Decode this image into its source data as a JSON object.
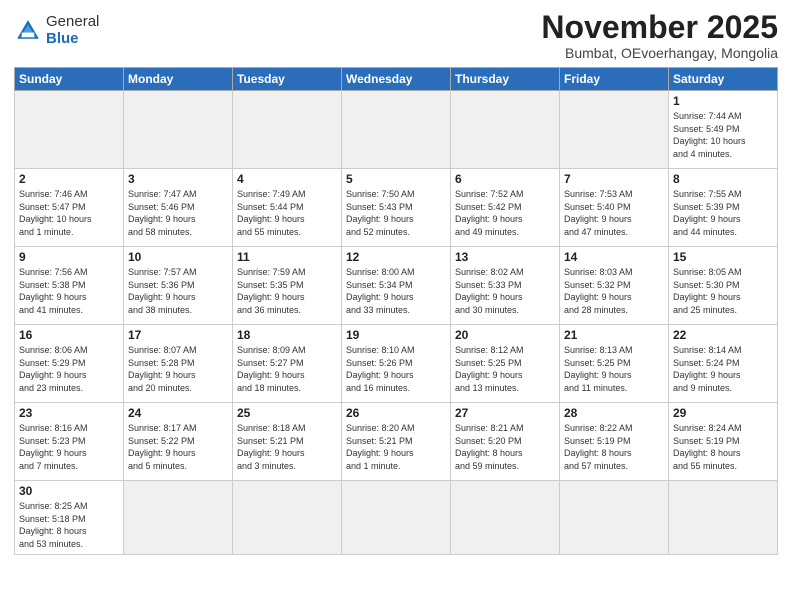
{
  "header": {
    "logo_general": "General",
    "logo_blue": "Blue",
    "month_title": "November 2025",
    "subtitle": "Bumbat, OEvoerhangay, Mongolia"
  },
  "days_of_week": [
    "Sunday",
    "Monday",
    "Tuesday",
    "Wednesday",
    "Thursday",
    "Friday",
    "Saturday"
  ],
  "weeks": [
    [
      {
        "day": "",
        "info": "",
        "empty": true
      },
      {
        "day": "",
        "info": "",
        "empty": true
      },
      {
        "day": "",
        "info": "",
        "empty": true
      },
      {
        "day": "",
        "info": "",
        "empty": true
      },
      {
        "day": "",
        "info": "",
        "empty": true
      },
      {
        "day": "",
        "info": "",
        "empty": true
      },
      {
        "day": "1",
        "info": "Sunrise: 7:44 AM\nSunset: 5:49 PM\nDaylight: 10 hours\nand 4 minutes."
      }
    ],
    [
      {
        "day": "2",
        "info": "Sunrise: 7:46 AM\nSunset: 5:47 PM\nDaylight: 10 hours\nand 1 minute."
      },
      {
        "day": "3",
        "info": "Sunrise: 7:47 AM\nSunset: 5:46 PM\nDaylight: 9 hours\nand 58 minutes."
      },
      {
        "day": "4",
        "info": "Sunrise: 7:49 AM\nSunset: 5:44 PM\nDaylight: 9 hours\nand 55 minutes."
      },
      {
        "day": "5",
        "info": "Sunrise: 7:50 AM\nSunset: 5:43 PM\nDaylight: 9 hours\nand 52 minutes."
      },
      {
        "day": "6",
        "info": "Sunrise: 7:52 AM\nSunset: 5:42 PM\nDaylight: 9 hours\nand 49 minutes."
      },
      {
        "day": "7",
        "info": "Sunrise: 7:53 AM\nSunset: 5:40 PM\nDaylight: 9 hours\nand 47 minutes."
      },
      {
        "day": "8",
        "info": "Sunrise: 7:55 AM\nSunset: 5:39 PM\nDaylight: 9 hours\nand 44 minutes."
      }
    ],
    [
      {
        "day": "9",
        "info": "Sunrise: 7:56 AM\nSunset: 5:38 PM\nDaylight: 9 hours\nand 41 minutes."
      },
      {
        "day": "10",
        "info": "Sunrise: 7:57 AM\nSunset: 5:36 PM\nDaylight: 9 hours\nand 38 minutes."
      },
      {
        "day": "11",
        "info": "Sunrise: 7:59 AM\nSunset: 5:35 PM\nDaylight: 9 hours\nand 36 minutes."
      },
      {
        "day": "12",
        "info": "Sunrise: 8:00 AM\nSunset: 5:34 PM\nDaylight: 9 hours\nand 33 minutes."
      },
      {
        "day": "13",
        "info": "Sunrise: 8:02 AM\nSunset: 5:33 PM\nDaylight: 9 hours\nand 30 minutes."
      },
      {
        "day": "14",
        "info": "Sunrise: 8:03 AM\nSunset: 5:32 PM\nDaylight: 9 hours\nand 28 minutes."
      },
      {
        "day": "15",
        "info": "Sunrise: 8:05 AM\nSunset: 5:30 PM\nDaylight: 9 hours\nand 25 minutes."
      }
    ],
    [
      {
        "day": "16",
        "info": "Sunrise: 8:06 AM\nSunset: 5:29 PM\nDaylight: 9 hours\nand 23 minutes."
      },
      {
        "day": "17",
        "info": "Sunrise: 8:07 AM\nSunset: 5:28 PM\nDaylight: 9 hours\nand 20 minutes."
      },
      {
        "day": "18",
        "info": "Sunrise: 8:09 AM\nSunset: 5:27 PM\nDaylight: 9 hours\nand 18 minutes."
      },
      {
        "day": "19",
        "info": "Sunrise: 8:10 AM\nSunset: 5:26 PM\nDaylight: 9 hours\nand 16 minutes."
      },
      {
        "day": "20",
        "info": "Sunrise: 8:12 AM\nSunset: 5:25 PM\nDaylight: 9 hours\nand 13 minutes."
      },
      {
        "day": "21",
        "info": "Sunrise: 8:13 AM\nSunset: 5:25 PM\nDaylight: 9 hours\nand 11 minutes."
      },
      {
        "day": "22",
        "info": "Sunrise: 8:14 AM\nSunset: 5:24 PM\nDaylight: 9 hours\nand 9 minutes."
      }
    ],
    [
      {
        "day": "23",
        "info": "Sunrise: 8:16 AM\nSunset: 5:23 PM\nDaylight: 9 hours\nand 7 minutes."
      },
      {
        "day": "24",
        "info": "Sunrise: 8:17 AM\nSunset: 5:22 PM\nDaylight: 9 hours\nand 5 minutes."
      },
      {
        "day": "25",
        "info": "Sunrise: 8:18 AM\nSunset: 5:21 PM\nDaylight: 9 hours\nand 3 minutes."
      },
      {
        "day": "26",
        "info": "Sunrise: 8:20 AM\nSunset: 5:21 PM\nDaylight: 9 hours\nand 1 minute."
      },
      {
        "day": "27",
        "info": "Sunrise: 8:21 AM\nSunset: 5:20 PM\nDaylight: 8 hours\nand 59 minutes."
      },
      {
        "day": "28",
        "info": "Sunrise: 8:22 AM\nSunset: 5:19 PM\nDaylight: 8 hours\nand 57 minutes."
      },
      {
        "day": "29",
        "info": "Sunrise: 8:24 AM\nSunset: 5:19 PM\nDaylight: 8 hours\nand 55 minutes."
      }
    ],
    [
      {
        "day": "30",
        "info": "Sunrise: 8:25 AM\nSunset: 5:18 PM\nDaylight: 8 hours\nand 53 minutes."
      },
      {
        "day": "",
        "info": "",
        "empty": true
      },
      {
        "day": "",
        "info": "",
        "empty": true
      },
      {
        "day": "",
        "info": "",
        "empty": true
      },
      {
        "day": "",
        "info": "",
        "empty": true
      },
      {
        "day": "",
        "info": "",
        "empty": true
      },
      {
        "day": "",
        "info": "",
        "empty": true
      }
    ]
  ]
}
